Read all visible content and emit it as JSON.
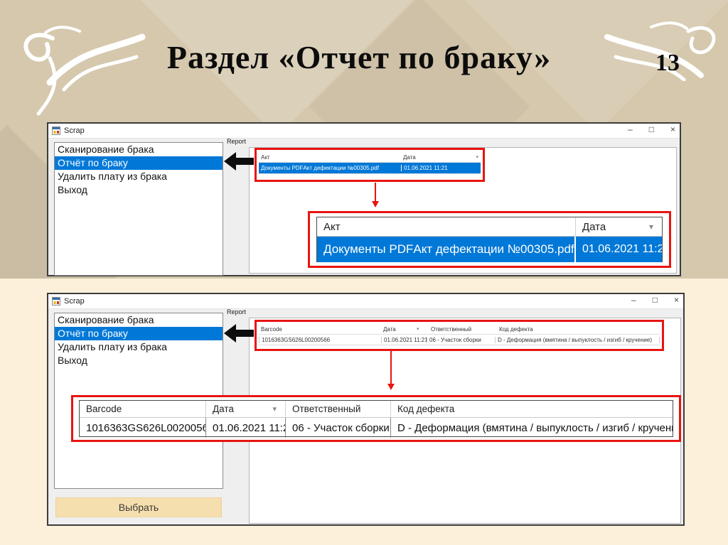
{
  "slide": {
    "title": "Раздел «Отчет по браку»",
    "page_number": "13"
  },
  "app": {
    "window_title": "Scrap",
    "report_label": "Report",
    "menu_items": [
      "Сканирование брака",
      "Отчёт по браку",
      "Удалить плату из брака",
      "Выход"
    ],
    "selected_menu_item": "Отчёт по браку",
    "select_button_label": "Выбрать"
  },
  "icons": {
    "minimize": "–",
    "maximize": "□",
    "close": "×",
    "sort_desc": "▾"
  },
  "report1": {
    "headers": [
      "Акт",
      "Дата"
    ],
    "row": [
      "Документы PDFАкт дефектации №00305.pdf",
      "01.06.2021 11:21"
    ]
  },
  "report2": {
    "headers": [
      "Barcode",
      "Дата",
      "Ответственный",
      "Код дефекта"
    ],
    "row": [
      "1016363GS626L00200566",
      "01.06.2021 11:21",
      "06 - Участок сборки",
      "D - Деформация (вмятина / выпуклость / изгиб / кручение)"
    ]
  },
  "colors": {
    "selection_blue": "#0078d7",
    "annotation_red": "#e81410",
    "button_bg": "#f6dfae",
    "background_tan": "#d5c8ad",
    "background_cream": "#fcf0da"
  }
}
